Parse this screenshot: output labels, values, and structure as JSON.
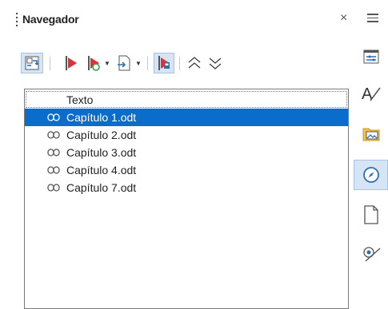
{
  "panel": {
    "title": "Navegador",
    "close_glyph": "×"
  },
  "toolbar": {
    "icons": [
      "toggle-icon",
      "previous-icon",
      "next-icon",
      "drag-mode-icon",
      "dropdown-arrow",
      "insert-icon",
      "dropdown-arrow",
      "content-view-icon",
      "promote-icon",
      "demote-icon"
    ]
  },
  "tree": {
    "root": "Texto",
    "items": [
      "Capítulo 1.odt",
      "Capítulo 2.odt",
      "Capítulo 3.odt",
      "Capítulo 4.odt",
      "Capítulo 7.odt"
    ]
  },
  "sidebar": {
    "icons": [
      "properties-icon",
      "styles-icon",
      "gallery-icon",
      "navigator-icon",
      "page-icon",
      "style-inspector-icon"
    ]
  },
  "colors": {
    "selection": "#0a6dcb",
    "accent_red": "#e0303a",
    "icon_blue": "#2a6fba"
  }
}
